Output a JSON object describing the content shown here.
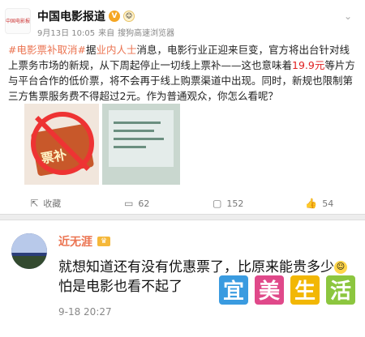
{
  "post": {
    "avatar_text": "中国电影报道",
    "author": "中国电影报道",
    "date": "9月13日 10:05",
    "source_prefix": "来自",
    "source": "搜狗高速浏览器",
    "content": {
      "tag": "#电影票补取消#",
      "pre_link": "据",
      "link": "业内人士",
      "text1": "消息，电影行业正迎来巨变，官方将出台针对线上票务市场的新规，从下周起停止一切线上票补——这也意味着",
      "price": "19.9元",
      "text2": "等片方与平台合作的低价票，将不会再于线上购票渠道中出现。同时，新规也限制第三方售票服务费不得超过2元。作为普通观众，你怎么看呢？"
    },
    "image_ticket_text": "票补",
    "actions": [
      {
        "icon": "forward-icon",
        "label": "收藏"
      },
      {
        "icon": "comment-icon",
        "label": "62"
      },
      {
        "icon": "repost-icon",
        "label": "152"
      },
      {
        "icon": "like-icon",
        "label": "54"
      }
    ]
  },
  "comment": {
    "name": "近无涯",
    "text_part1": "就想知道还有没有优惠票了，比原来能贵多少",
    "text_part2": "怕是电影也看不起了",
    "time": "9-18 20:27"
  },
  "watermark": {
    "chars": [
      "宜",
      "美",
      "生",
      "活"
    ],
    "colors": [
      "#3a9be0",
      "#e0498a",
      "#f2b705",
      "#8cc63f"
    ]
  },
  "colors": {
    "accent": "#eb7350",
    "highlight": "#e02020",
    "divider": "#ededed"
  }
}
